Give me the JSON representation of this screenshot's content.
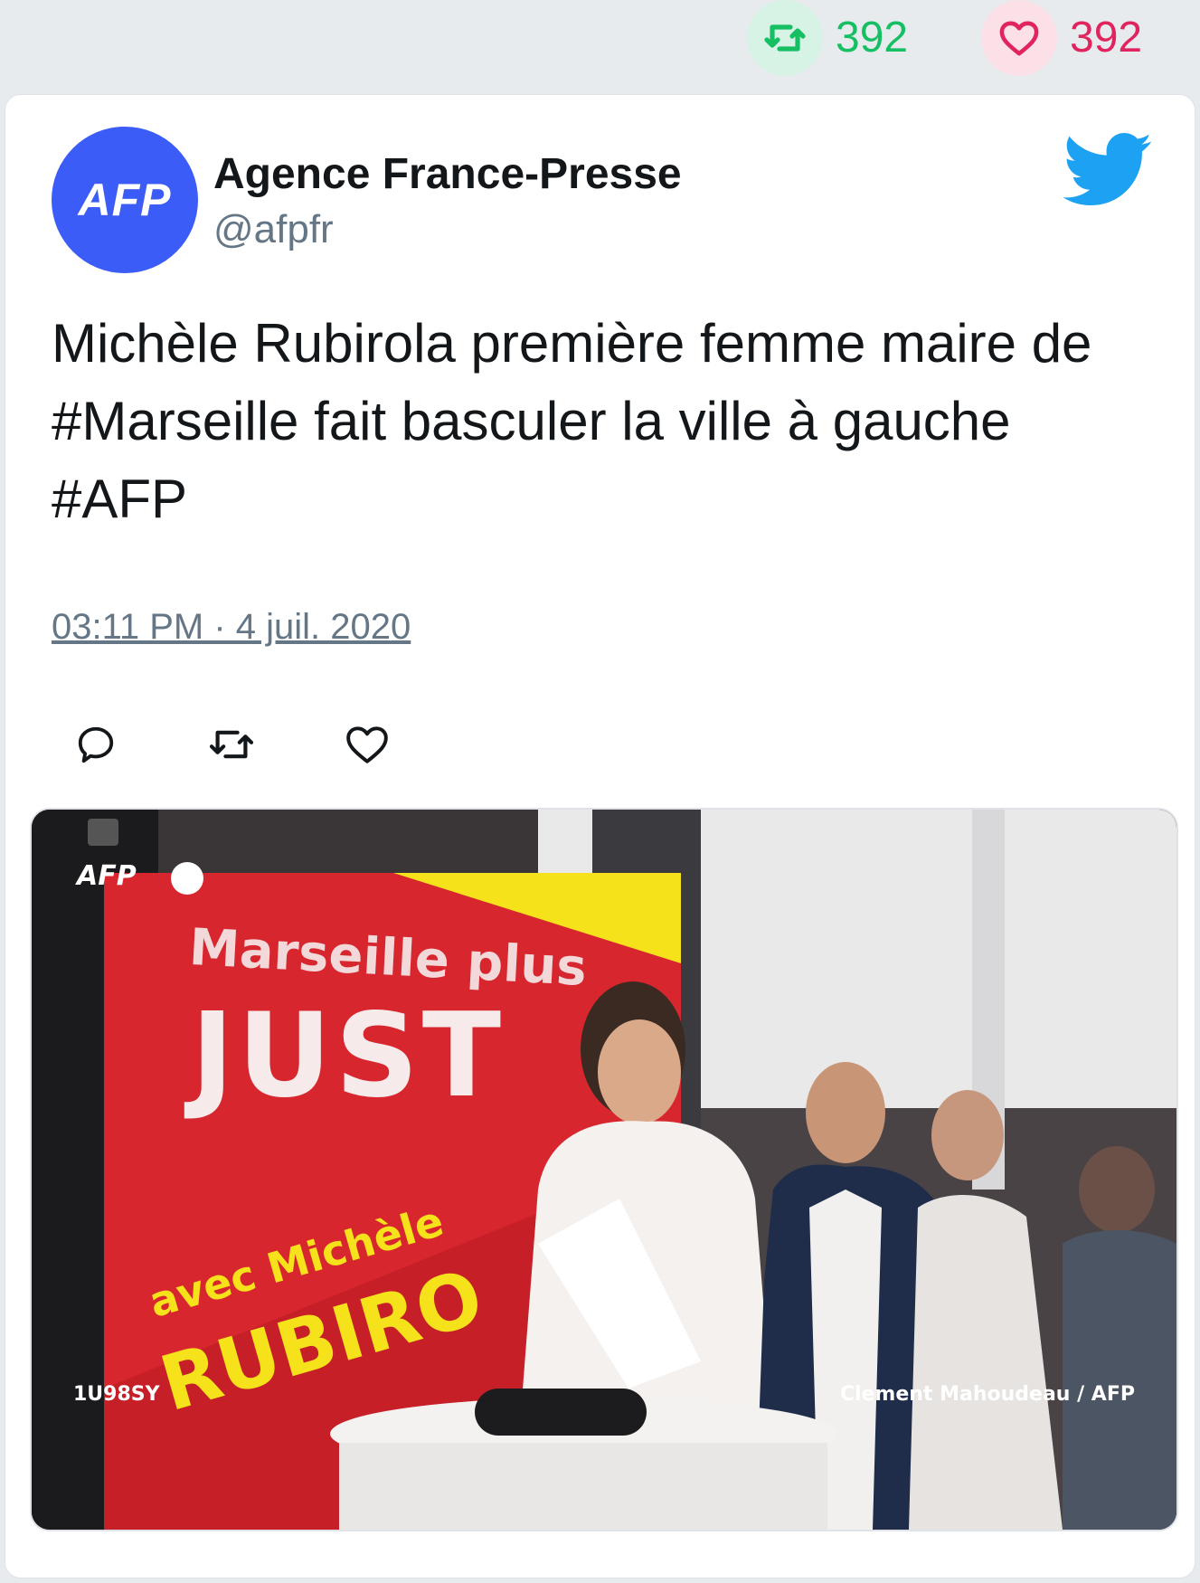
{
  "stats": {
    "retweets": "392",
    "likes": "392",
    "retweet_icon": "retweet-icon",
    "like_icon": "heart-icon",
    "retweet_color": "#17bf63",
    "like_color": "#e0245e"
  },
  "tweet": {
    "avatar_text": "AFP",
    "author_name": "Agence France-Presse",
    "author_handle": "@afpfr",
    "text": "Michèle Rubirola première femme maire de #Marseille fait basculer la ville à gauche #AFP",
    "timestamp": "03:11 PM · 4 juil. 2020",
    "actions": [
      "reply-icon",
      "retweet-icon",
      "heart-icon"
    ]
  },
  "photo": {
    "watermark": "AFP",
    "banner_line1": "Marseille plus",
    "banner_line2": "JUST",
    "banner_line3": "avec Michèle",
    "banner_line4": "RUBIRO",
    "code": "1U98SY",
    "credit": "Clement Mahoudeau / AFP"
  },
  "colors": {
    "avatar_bg": "#3b5cf6",
    "twitter_blue": "#1da1f2",
    "banner_red": "#d8262f",
    "banner_yellow": "#f5e21b"
  }
}
